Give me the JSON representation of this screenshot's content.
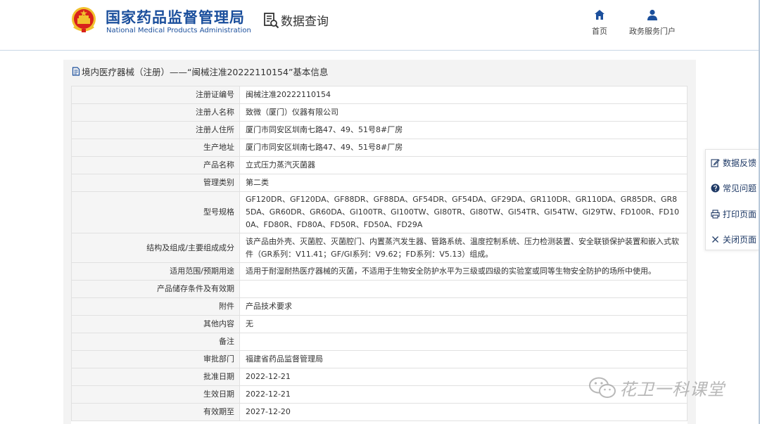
{
  "header": {
    "brand_cn": "国家药品监督管理局",
    "brand_en": "National Medical Products Administration",
    "query_label": "数据查询",
    "nav": [
      {
        "label": "首页",
        "icon": "home-icon"
      },
      {
        "label": "政务服务门户",
        "icon": "user-icon"
      }
    ]
  },
  "panel": {
    "title": "境内医疗器械（注册）——“闽械注准20222110154”基本信息"
  },
  "record": {
    "rows": [
      {
        "key": "注册证编号",
        "value": "闽械注准20222110154"
      },
      {
        "key": "注册人名称",
        "value": "致微（厦门）仪器有限公司"
      },
      {
        "key": "注册人住所",
        "value": "厦门市同安区圳南七路47、49、51号8#厂房"
      },
      {
        "key": "生产地址",
        "value": "厦门市同安区圳南七路47、49、51号8#厂房"
      },
      {
        "key": "产品名称",
        "value": "立式压力蒸汽灭菌器"
      },
      {
        "key": "管理类别",
        "value": "第二类"
      },
      {
        "key": "型号规格",
        "value": "GF120DR、GF120DA、GF88DR、GF88DA、GF54DR、GF54DA、GF29DA、GR110DR、GR110DA、GR85DR、GR85DA、GR60DR、GR60DA、GI100TR、GI100TW、GI80TR、GI80TW、GI54TR、GI54TW、GI29TW、FD100R、FD100A、FD80R、FD80A、FD50R、FD50A、FD29A"
      },
      {
        "key": "结构及组成/主要组成成分",
        "value": "该产品由外壳、灭菌腔、灭菌腔门、内置蒸汽发生器、管路系统、温度控制系统、压力检测装置、安全联锁保护装置和嵌入式软件（GR系列：V11.41；GF/GI系列：V9.62；FD系列：V5.13）组成。"
      },
      {
        "key": "适用范围/预期用途",
        "value": "适用于耐湿耐热医疗器械的灭菌，不适用于生物安全防护水平为三级或四级的实验室或同等生物安全防护的场所中使用。"
      },
      {
        "key": "产品储存条件及有效期",
        "value": ""
      },
      {
        "key": "附件",
        "value": "产品技术要求"
      },
      {
        "key": "其他内容",
        "value": "无"
      },
      {
        "key": "备注",
        "value": ""
      },
      {
        "key": "审批部门",
        "value": "福建省药品监督管理局"
      },
      {
        "key": "批准日期",
        "value": "2022-12-21"
      },
      {
        "key": "生效日期",
        "value": "2022-12-21"
      },
      {
        "key": "有效期至",
        "value": "2027-12-20"
      }
    ]
  },
  "sidebar": {
    "items": [
      {
        "label": "数据反馈",
        "icon": "edit-icon"
      },
      {
        "label": "常见问题",
        "icon": "question-icon"
      },
      {
        "label": "打印页面",
        "icon": "print-icon"
      },
      {
        "label": "关闭页面",
        "icon": "close-icon"
      }
    ]
  },
  "watermark": {
    "text": "花卫一科课堂",
    "icon": "wechat-icon"
  },
  "colors": {
    "brand_blue": "#1b4f9c",
    "emblem_red": "#d8221c",
    "emblem_gold": "#f2c12e",
    "panel_bg": "#f3f3f3",
    "key_bg": "#f5f5f5",
    "sidebar_text": "#1f3a66"
  }
}
